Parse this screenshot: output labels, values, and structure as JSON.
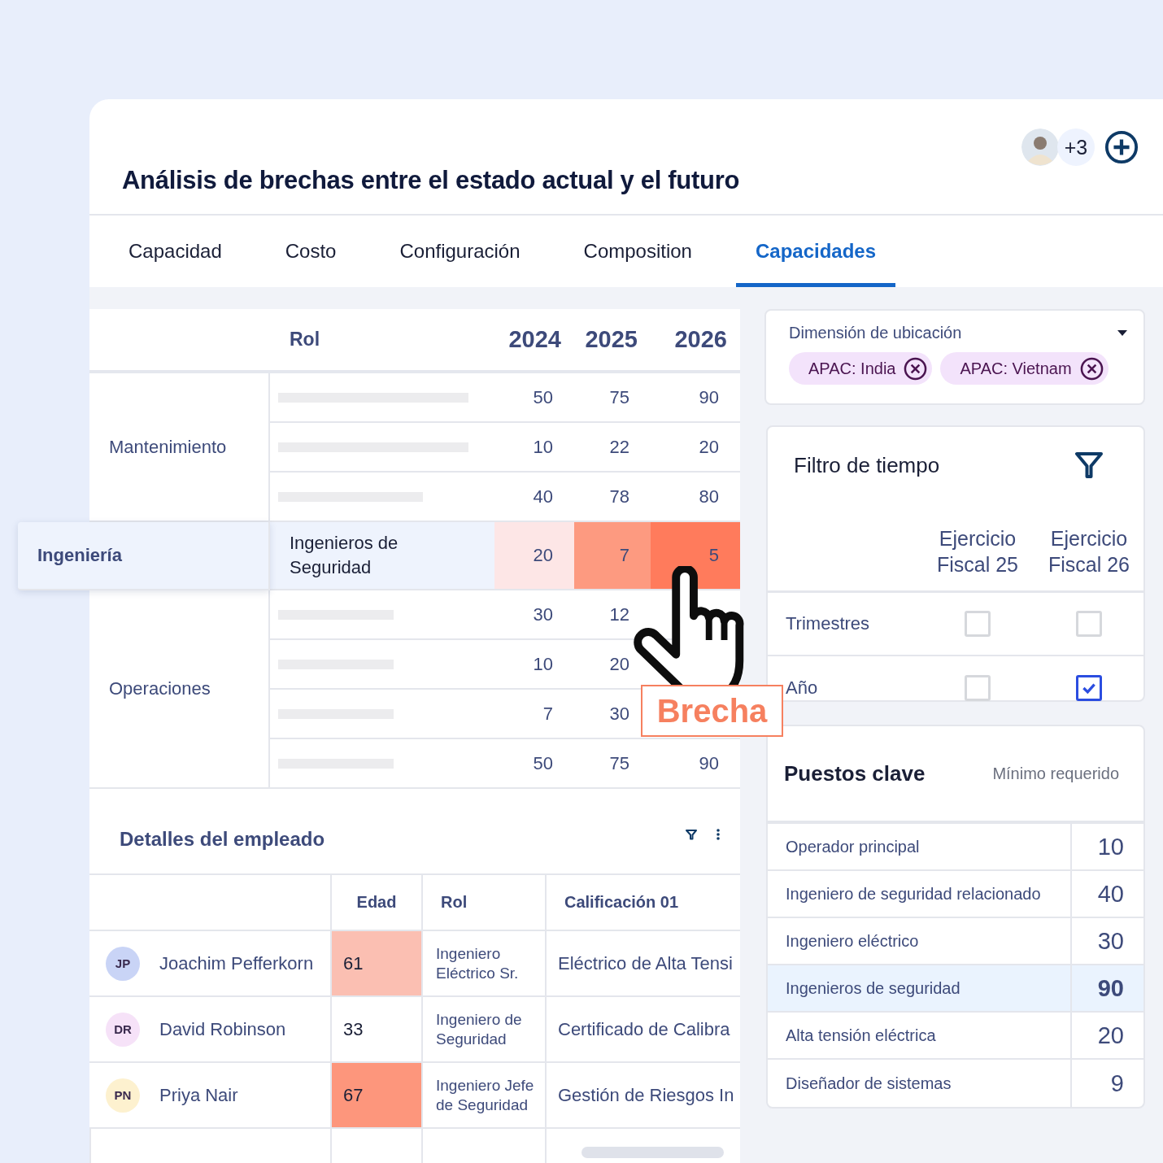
{
  "header": {
    "title": "Análisis de brechas entre el estado actual y el futuro",
    "more_collaborators": "+3"
  },
  "tabs": [
    {
      "label": "Capacidad",
      "selected": false
    },
    {
      "label": "Costo",
      "selected": false
    },
    {
      "label": "Configuración",
      "selected": false
    },
    {
      "label": "Composition",
      "selected": false
    },
    {
      "label": "Capacidades",
      "selected": true
    }
  ],
  "gap_table": {
    "columns": [
      "Rol",
      "2024",
      "2025",
      "2026"
    ],
    "groups": [
      {
        "name": "Mantenimiento",
        "selected": false,
        "rows": [
          {
            "cells": [
              {
                "value": "50"
              },
              {
                "value": "75"
              },
              {
                "value": "90"
              }
            ]
          },
          {
            "cells": [
              {
                "value": "10"
              },
              {
                "value": "22"
              },
              {
                "value": "20"
              }
            ]
          },
          {
            "cells": [
              {
                "value": "40"
              },
              {
                "value": "78"
              },
              {
                "value": "80"
              }
            ]
          }
        ]
      },
      {
        "name": "Ingeniería",
        "selected": true,
        "rows": [
          {
            "role": "Ingenieros de Seguridad",
            "cells": [
              {
                "value": "20",
                "color": "#fde6e6"
              },
              {
                "value": "7",
                "color": "#fd9a80"
              },
              {
                "value": "5",
                "color": "#ff7b5c"
              }
            ]
          }
        ]
      },
      {
        "name": "Operaciones",
        "selected": false,
        "rows": [
          {
            "cells": [
              {
                "value": "30"
              },
              {
                "value": "12"
              }
            ]
          },
          {
            "cells": [
              {
                "value": "10"
              },
              {
                "value": "20"
              }
            ]
          },
          {
            "cells": [
              {
                "value": "7"
              },
              {
                "value": "30"
              }
            ]
          },
          {
            "cells": [
              {
                "value": "50"
              },
              {
                "value": "75"
              },
              {
                "value": "90"
              }
            ]
          }
        ]
      }
    ]
  },
  "callout": {
    "label": "Brecha"
  },
  "employees": {
    "title": "Detalles del empleado",
    "columns": [
      "Edad",
      "Rol",
      "Calificación 01"
    ],
    "rows": [
      {
        "avatar": {
          "initials": "JP",
          "color": "#c9d4f6"
        },
        "name": "Joachim Pefferkorn",
        "age": {
          "value": "61",
          "color": "#fbbfb2"
        },
        "role": "Ingeniero Eléctrico Sr.",
        "qualification": "Eléctrico de Alta Tensi"
      },
      {
        "avatar": {
          "initials": "DR",
          "color": "#f6e2f8"
        },
        "name": "David Robinson",
        "age": {
          "value": "33"
        },
        "role": "Ingeniero de Seguridad",
        "qualification": "Certificado de Calibra"
      },
      {
        "avatar": {
          "initials": "PN",
          "color": "#fdf1cf"
        },
        "name": "Priya Nair",
        "age": {
          "value": "67",
          "color": "#fd967c"
        },
        "role": "Ingeniero Jefe de Seguridad",
        "qualification": "Gestión de Riesgos In"
      }
    ]
  },
  "location": {
    "label": "Dimensión de ubicación",
    "chips": [
      "APAC: India",
      "APAC: Vietnam"
    ]
  },
  "time_filter": {
    "title": "Filtro de tiempo",
    "columns": [
      "Ejercicio Fiscal 25",
      "Ejercicio Fiscal 26"
    ],
    "rows": [
      {
        "label": "Trimestres",
        "checks": [
          false,
          false
        ]
      },
      {
        "label": "Año",
        "checks": [
          false,
          true
        ]
      }
    ]
  },
  "key_positions": {
    "title": "Puestos clave",
    "subtitle": "Mínimo requerido",
    "rows": [
      {
        "name": "Operador principal",
        "value": "10",
        "selected": false
      },
      {
        "name": "Ingeniero de seguridad relacionado",
        "value": "40",
        "selected": false
      },
      {
        "name": "Ingeniero eléctrico",
        "value": "30",
        "selected": false
      },
      {
        "name": "Ingenieros de seguridad",
        "value": "90",
        "selected": true
      },
      {
        "name": "Alta tensión eléctrica",
        "value": "20",
        "selected": false
      },
      {
        "name": "Diseñador de sistemas",
        "value": "9",
        "selected": false
      }
    ]
  }
}
